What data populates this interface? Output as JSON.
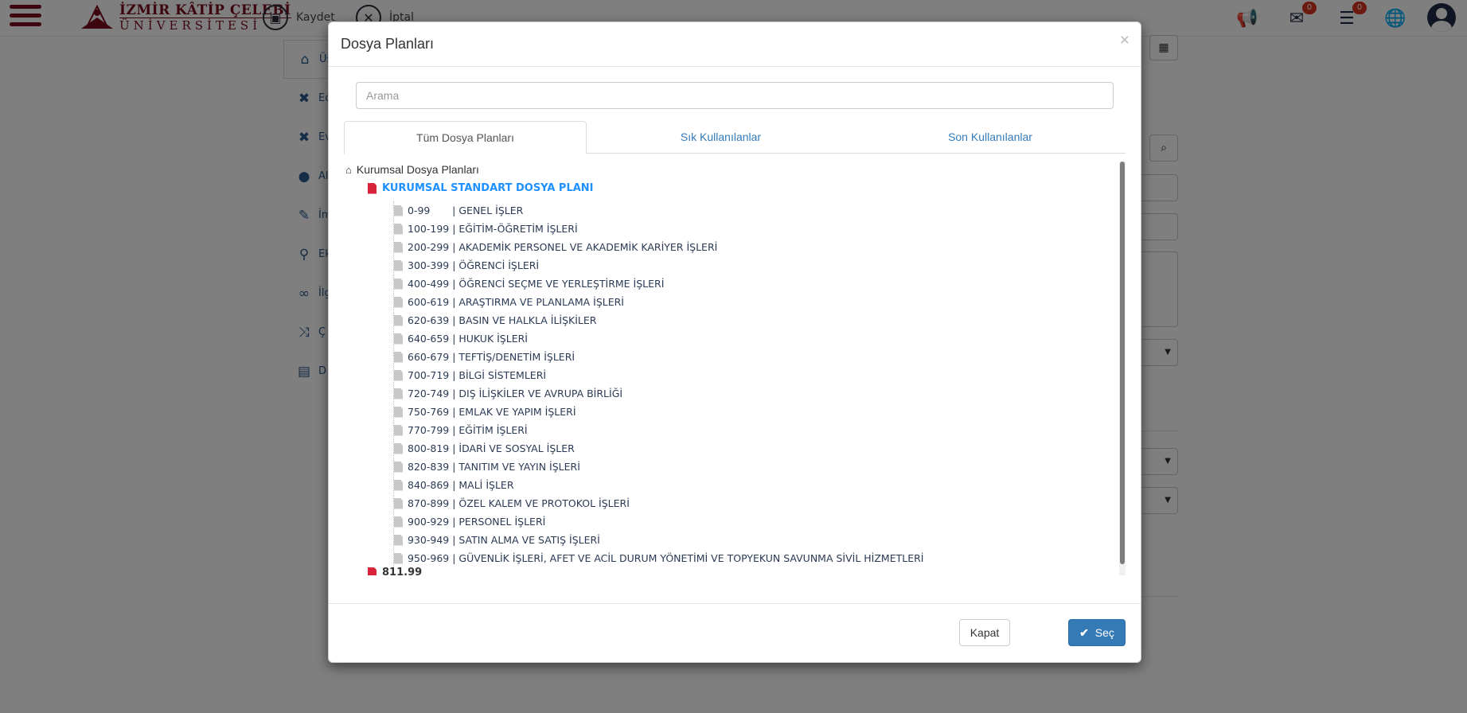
{
  "topbar": {
    "logo_line1": "İZMİR KÂTİP ÇELEBİ",
    "logo_line2": "ÜNİVERSİTESİ",
    "save_label": "Kaydet",
    "cancel_label": "İptal",
    "mail_count": "0",
    "tasks_count": "0"
  },
  "sidemenu": {
    "items": [
      "Üs",
      "Ed",
      "Ev",
      "Al",
      "İm",
      "Ek",
      "İlg",
      "Ç",
      "D"
    ]
  },
  "modal": {
    "title": "Dosya Planları",
    "close_symbol": "×",
    "search_placeholder": "Arama",
    "tabs": [
      "Tüm Dosya Planları",
      "Sık Kullanılanlar",
      "Son Kullanılanlar"
    ],
    "tree": {
      "root_label": "Kurumsal Dosya Planları",
      "plan_label": "KURUMSAL STANDART DOSYA PLANI",
      "items": [
        "0-99       | GENEL İŞLER",
        "100-199 | EĞİTİM-ÖĞRETİM İŞLERİ",
        "200-299 | AKADEMİK PERSONEL VE AKADEMİK KARİYER İŞLERİ",
        "300-399 | ÖĞRENCİ İŞLERİ",
        "400-499 | ÖĞRENCİ SEÇME VE YERLEŞTİRME İŞLERİ",
        "600-619 | ARAŞTIRMA VE PLANLAMA İŞLERİ",
        "620-639 | BASIN VE HALKLA İLİŞKİLER",
        "640-659 | HUKUK İŞLERİ",
        "660-679 | TEFTİŞ/DENETİM İŞLERİ",
        "700-719 | BİLGİ SİSTEMLERİ",
        "720-749 | DIŞ İLİŞKİLER VE AVRUPA BİRLİĞİ",
        "750-769 | EMLAK VE YAPIM İŞLERİ",
        "770-799 | EĞİTİM İŞLERİ",
        "800-819 | İDARİ VE SOSYAL İŞLER",
        "820-839 | TANITIM VE YAYIN İŞLERİ",
        "840-869 | MALİ İŞLER",
        "870-899 | ÖZEL KALEM VE PROTOKOL İŞLERİ",
        "900-929 | PERSONEL İŞLERİ",
        "930-949 | SATIN ALMA VE SATIŞ İŞLERİ",
        "950-969 | GÜVENLİK İŞLERİ, AFET VE ACİL DURUM YÖNETİMİ VE TOPYEKUN SAVUNMA SİVİL HİZMETLERİ"
      ],
      "second_plan_label": "811.99"
    },
    "close_button": "Kapat",
    "select_button": "Seç"
  }
}
